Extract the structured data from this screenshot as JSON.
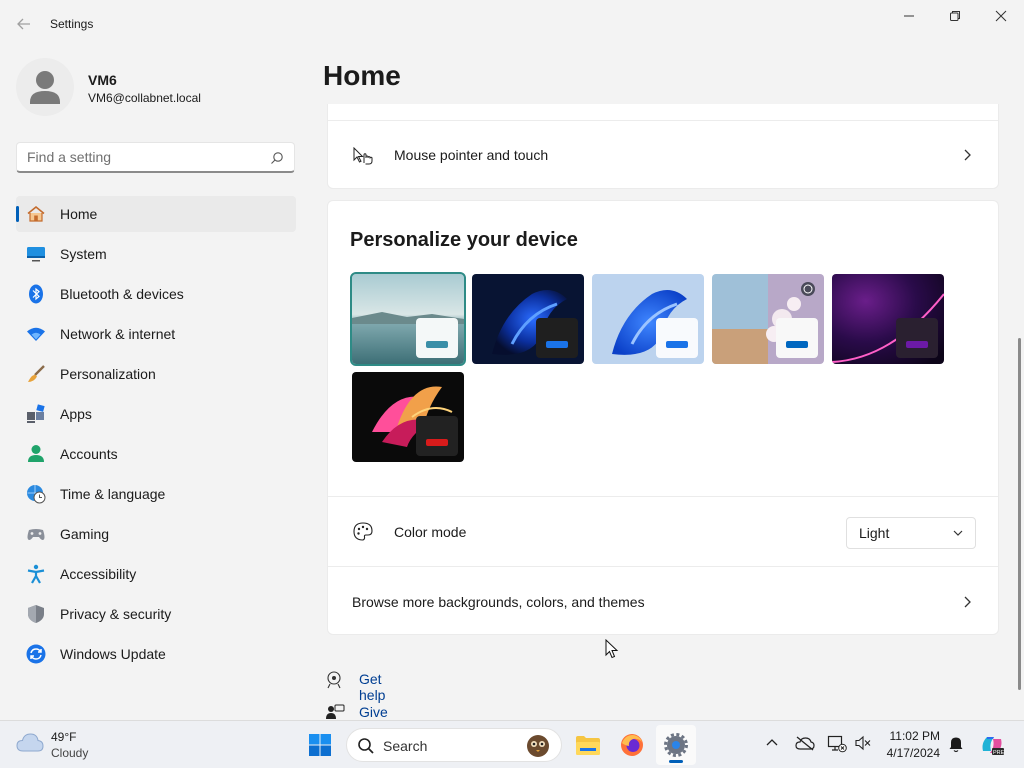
{
  "window": {
    "title": "Settings"
  },
  "user": {
    "name": "VM6",
    "email": "VM6@collabnet.local"
  },
  "search": {
    "placeholder": "Find a setting"
  },
  "sidebar": {
    "items": [
      {
        "label": "Home",
        "icon": "home-icon",
        "active": true
      },
      {
        "label": "System",
        "icon": "system-icon"
      },
      {
        "label": "Bluetooth & devices",
        "icon": "bluetooth-icon"
      },
      {
        "label": "Network & internet",
        "icon": "wifi-icon"
      },
      {
        "label": "Personalization",
        "icon": "brush-icon"
      },
      {
        "label": "Apps",
        "icon": "apps-icon"
      },
      {
        "label": "Accounts",
        "icon": "accounts-icon"
      },
      {
        "label": "Time & language",
        "icon": "globe-clock-icon"
      },
      {
        "label": "Gaming",
        "icon": "gamepad-icon"
      },
      {
        "label": "Accessibility",
        "icon": "accessibility-icon"
      },
      {
        "label": "Privacy & security",
        "icon": "shield-icon"
      },
      {
        "label": "Windows Update",
        "icon": "update-icon"
      }
    ]
  },
  "main": {
    "title": "Home",
    "mouse_row": {
      "label": "Mouse pointer and touch"
    },
    "personalize": {
      "title": "Personalize your device",
      "themes": [
        {
          "name": "theme-1",
          "selected": true,
          "bar_color": "#3a8fa8"
        },
        {
          "name": "theme-2",
          "bar_color": "#1a73e8"
        },
        {
          "name": "theme-3",
          "bar_color": "#1a73e8"
        },
        {
          "name": "theme-4",
          "bar_color": "#0067c0"
        },
        {
          "name": "theme-5",
          "bar_color": "#6c1aa6"
        },
        {
          "name": "theme-6",
          "bar_color": "#d81b1b"
        }
      ],
      "color_mode": {
        "label": "Color mode",
        "value": "Light"
      },
      "browse": {
        "label": "Browse more backgrounds, colors, and themes"
      }
    },
    "links": {
      "help": "Get help",
      "feedback": "Give feedback"
    }
  },
  "taskbar": {
    "weather": {
      "temp": "49°F",
      "desc": "Cloudy"
    },
    "search_label": "Search",
    "clock": {
      "time": "11:02 PM",
      "date": "4/17/2024"
    }
  },
  "colors": {
    "accent": "#005fb8",
    "background": "#f3f3f3",
    "card": "#ffffff",
    "link": "#003e92"
  }
}
